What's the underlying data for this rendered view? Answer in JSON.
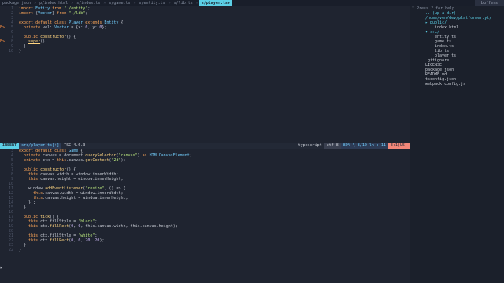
{
  "tabs": [
    {
      "label": "package.json",
      "active": false
    },
    {
      "label": "p/index.html",
      "active": false
    },
    {
      "label": "s/index.ts",
      "active": false
    },
    {
      "label": "s/game.ts",
      "active": false
    },
    {
      "label": "s/entity.ts",
      "active": false
    },
    {
      "label": "s/lib.ts",
      "active": false
    },
    {
      "label": "s/player.ts+",
      "active": true
    }
  ],
  "tab_separator": "»",
  "buffers_label": "buffers",
  "top_pane": {
    "lines": [
      {
        "n": "1",
        "tokens": [
          [
            "k",
            "import "
          ],
          [
            "t",
            "Entity"
          ],
          [
            "k",
            " from "
          ],
          [
            "s",
            "\"./entity\""
          ],
          [
            "p",
            ";"
          ]
        ]
      },
      {
        "n": "2",
        "tokens": [
          [
            "k",
            "import "
          ],
          [
            "p",
            "{"
          ],
          [
            "t",
            "Vector"
          ],
          [
            "p",
            "}"
          ],
          [
            "k",
            " from "
          ],
          [
            "s",
            "\"./lib\""
          ],
          [
            "p",
            ";"
          ]
        ]
      },
      {
        "n": "3",
        "tokens": []
      },
      {
        "n": "4",
        "tokens": [
          [
            "k",
            "export default class "
          ],
          [
            "t",
            "Player"
          ],
          [
            "k",
            " extends "
          ],
          [
            "t",
            "Entity"
          ],
          [
            "p",
            " {"
          ]
        ]
      },
      {
        "n": "5",
        "sign": "E>",
        "tokens": [
          [
            "k",
            "  private "
          ],
          [
            "p",
            "vel: "
          ],
          [
            "t",
            "Vector"
          ],
          [
            "p",
            " = {x: "
          ],
          [
            "n",
            "0"
          ],
          [
            "p",
            ", y: "
          ],
          [
            "n",
            "0"
          ],
          [
            "p",
            "};"
          ]
        ]
      },
      {
        "n": "6",
        "tokens": []
      },
      {
        "n": "7",
        "tokens": [
          [
            "k",
            "  public "
          ],
          [
            "f",
            "constructor"
          ],
          [
            "p",
            "() {"
          ]
        ]
      },
      {
        "n": "8",
        "sign": "E>",
        "tokens": [
          [
            "p",
            "    "
          ],
          [
            "cw",
            "super"
          ],
          [
            "p",
            "()"
          ]
        ]
      },
      {
        "n": "9",
        "tokens": [
          [
            "p",
            "  }"
          ]
        ]
      },
      {
        "n": "10",
        "tokens": [
          [
            "p",
            "}"
          ]
        ]
      }
    ]
  },
  "status": {
    "mode": "INSERT",
    "file": "src/player.ts[+]",
    "tsc": "TSC 4.6.3",
    "filetype": "typescript",
    "encoding": "utf-8",
    "position": "80% \\ 8/10 ln : 11",
    "diag": "E:1(L5)"
  },
  "bottom_pane": {
    "lines": [
      {
        "n": "3",
        "tokens": [
          [
            "k",
            "export default class "
          ],
          [
            "t",
            "Game"
          ],
          [
            "p",
            " {"
          ]
        ]
      },
      {
        "n": "4",
        "tokens": [
          [
            "k",
            "  private "
          ],
          [
            "p",
            "canvas = document."
          ],
          [
            "f",
            "querySelector"
          ],
          [
            "p",
            "("
          ],
          [
            "s",
            "\"canvas\""
          ],
          [
            "p",
            ") "
          ],
          [
            "k",
            "as "
          ],
          [
            "t",
            "HTMLCanvasElement"
          ],
          [
            "p",
            ";"
          ]
        ]
      },
      {
        "n": "5",
        "tokens": [
          [
            "k",
            "  private "
          ],
          [
            "p",
            "ctx = "
          ],
          [
            "k",
            "this"
          ],
          [
            "p",
            ".canvas."
          ],
          [
            "f",
            "getContext"
          ],
          [
            "p",
            "("
          ],
          [
            "s",
            "\"2d\""
          ],
          [
            "p",
            ");"
          ]
        ]
      },
      {
        "n": "6",
        "tokens": []
      },
      {
        "n": "7",
        "tokens": [
          [
            "k",
            "  public "
          ],
          [
            "f",
            "constructor"
          ],
          [
            "p",
            "() {"
          ]
        ]
      },
      {
        "n": "8",
        "tokens": [
          [
            "k",
            "    this"
          ],
          [
            "p",
            ".canvas.width = window.innerWidth;"
          ]
        ]
      },
      {
        "n": "9",
        "tokens": [
          [
            "k",
            "    this"
          ],
          [
            "p",
            ".canvas.height = window.innerHeight;"
          ]
        ]
      },
      {
        "n": "10",
        "tokens": []
      },
      {
        "n": "11",
        "tokens": [
          [
            "p",
            "    window."
          ],
          [
            "f",
            "addEventListener"
          ],
          [
            "p",
            "("
          ],
          [
            "s",
            "\"resize\""
          ],
          [
            "p",
            ", () => {"
          ]
        ]
      },
      {
        "n": "12",
        "tokens": [
          [
            "k",
            "      this"
          ],
          [
            "p",
            ".canvas.width = window.innerWidth;"
          ]
        ]
      },
      {
        "n": "13",
        "tokens": [
          [
            "k",
            "      this"
          ],
          [
            "p",
            ".canvas.height = window.innerHeight;"
          ]
        ]
      },
      {
        "n": "14",
        "tokens": [
          [
            "p",
            "    });"
          ]
        ]
      },
      {
        "n": "15",
        "tokens": [
          [
            "p",
            "  }"
          ]
        ]
      },
      {
        "n": "16",
        "tokens": []
      },
      {
        "n": "17",
        "tokens": [
          [
            "k",
            "  public "
          ],
          [
            "f",
            "tick"
          ],
          [
            "p",
            "() {"
          ]
        ]
      },
      {
        "n": "18",
        "tokens": [
          [
            "k",
            "    this"
          ],
          [
            "p",
            ".ctx.fillStyle = "
          ],
          [
            "s",
            "\"black\""
          ],
          [
            "p",
            ";"
          ]
        ]
      },
      {
        "n": "19",
        "tokens": [
          [
            "k",
            "    this"
          ],
          [
            "p",
            ".ctx."
          ],
          [
            "f",
            "fillRect"
          ],
          [
            "p",
            "("
          ],
          [
            "n",
            "0"
          ],
          [
            "p",
            ", "
          ],
          [
            "n",
            "0"
          ],
          [
            "p",
            ", this.canvas.width, this.canvas.height);"
          ]
        ]
      },
      {
        "n": "20",
        "tokens": []
      },
      {
        "n": "21",
        "tokens": [
          [
            "k",
            "    this"
          ],
          [
            "p",
            ".ctx.fillStyle = "
          ],
          [
            "s",
            "\"white\""
          ],
          [
            "p",
            ";"
          ]
        ]
      },
      {
        "n": "22",
        "tokens": [
          [
            "k",
            "    this"
          ],
          [
            "p",
            ".ctx."
          ],
          [
            "f",
            "fillRect"
          ],
          [
            "p",
            "("
          ],
          [
            "n",
            "0"
          ],
          [
            "p",
            ", "
          ],
          [
            "n",
            "0"
          ],
          [
            "p",
            ", "
          ],
          [
            "n",
            "20"
          ],
          [
            "p",
            ", "
          ],
          [
            "n",
            "20"
          ],
          [
            "p",
            ");"
          ]
        ]
      },
      {
        "n": "23",
        "tokens": [
          [
            "p",
            "  }"
          ]
        ]
      },
      {
        "n": "22",
        "tokens": [
          [
            "p",
            "}"
          ]
        ]
      }
    ]
  },
  "explorer": {
    "help": "\" Press ? for help",
    "up": ".. (up a dir)",
    "root": "/home/ven/dev/platformer.yt/",
    "items": [
      {
        "text": "▸ public/",
        "indent": 0,
        "kind": "dir"
      },
      {
        "text": "  index.html",
        "indent": 1,
        "kind": "file"
      },
      {
        "text": "▾ src/",
        "indent": 0,
        "kind": "dir"
      },
      {
        "text": "  entity.ts",
        "indent": 1,
        "kind": "file"
      },
      {
        "text": "  game.ts",
        "indent": 1,
        "kind": "file"
      },
      {
        "text": "  index.ts",
        "indent": 1,
        "kind": "file"
      },
      {
        "text": "  lib.ts",
        "indent": 1,
        "kind": "file"
      },
      {
        "text": "  player.ts",
        "indent": 1,
        "kind": "file"
      },
      {
        "text": ".gitignore",
        "indent": 0,
        "kind": "file"
      },
      {
        "text": "LICENSE",
        "indent": 0,
        "kind": "file"
      },
      {
        "text": "package.json",
        "indent": 0,
        "kind": "file"
      },
      {
        "text": "README.md",
        "indent": 0,
        "kind": "file"
      },
      {
        "text": "tsconfig.json",
        "indent": 0,
        "kind": "file"
      },
      {
        "text": "webpack.config.js",
        "indent": 0,
        "kind": "file"
      }
    ]
  }
}
